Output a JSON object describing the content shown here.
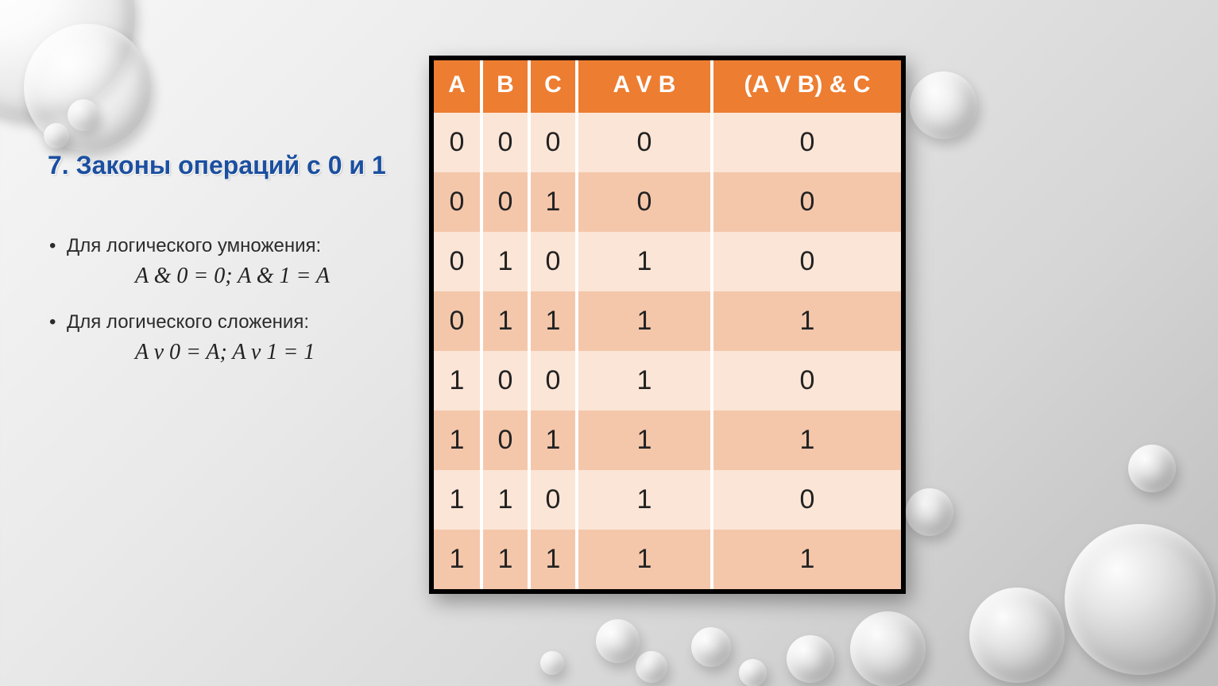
{
  "heading": "7. Законы операций с 0 и 1",
  "bullets": {
    "mult_label": "Для логического умножения:",
    "mult_formula": "A & 0 = 0;    A & 1 = A",
    "add_label": "Для логического сложения:",
    "add_formula": "A v 0 = A;    A v 1 = 1"
  },
  "table": {
    "headers": [
      "A",
      "B",
      "C",
      "A V B",
      "(A V B) & C"
    ],
    "rows": [
      [
        "0",
        "0",
        "0",
        "0",
        "0"
      ],
      [
        "0",
        "0",
        "1",
        "0",
        "0"
      ],
      [
        "0",
        "1",
        "0",
        "1",
        "0"
      ],
      [
        "0",
        "1",
        "1",
        "1",
        "1"
      ],
      [
        "1",
        "0",
        "0",
        "1",
        "0"
      ],
      [
        "1",
        "0",
        "1",
        "1",
        "1"
      ],
      [
        "1",
        "1",
        "0",
        "1",
        "0"
      ],
      [
        "1",
        "1",
        "1",
        "1",
        "1"
      ]
    ]
  }
}
